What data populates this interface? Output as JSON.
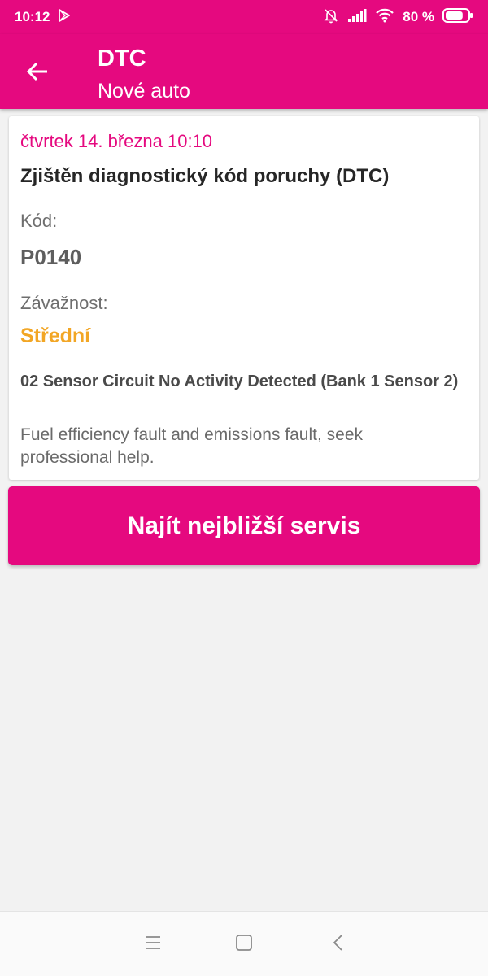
{
  "status_bar": {
    "time": "10:12",
    "battery_percent": "80 %",
    "battery_level": 0.8,
    "icons": [
      "play-store-icon",
      "bell-muted-icon",
      "signal-icon",
      "wifi-icon",
      "battery-icon"
    ]
  },
  "app_bar": {
    "title": "DTC",
    "subtitle": "Nové auto",
    "back_icon": "arrow-back-icon",
    "color": "#e5097f"
  },
  "card": {
    "date": "čtvrtek 14. března 10:10",
    "title": "Zjištěn diagnostický kód poruchy (DTC)",
    "code_label": "Kód:",
    "code_value": "P0140",
    "severity_label": "Závažnost:",
    "severity_value": "Střední",
    "severity_color": "#f2a625",
    "description": "02 Sensor Circuit No Activity Detected (Bank 1 Sensor 2)",
    "advice": "Fuel efficiency fault and emissions fault, seek professional help."
  },
  "action": {
    "button_label": "Najít nejbližší servis"
  },
  "nav_bar": {
    "icons": [
      "menu-icon",
      "home-square-icon",
      "back-chevron-icon"
    ]
  }
}
